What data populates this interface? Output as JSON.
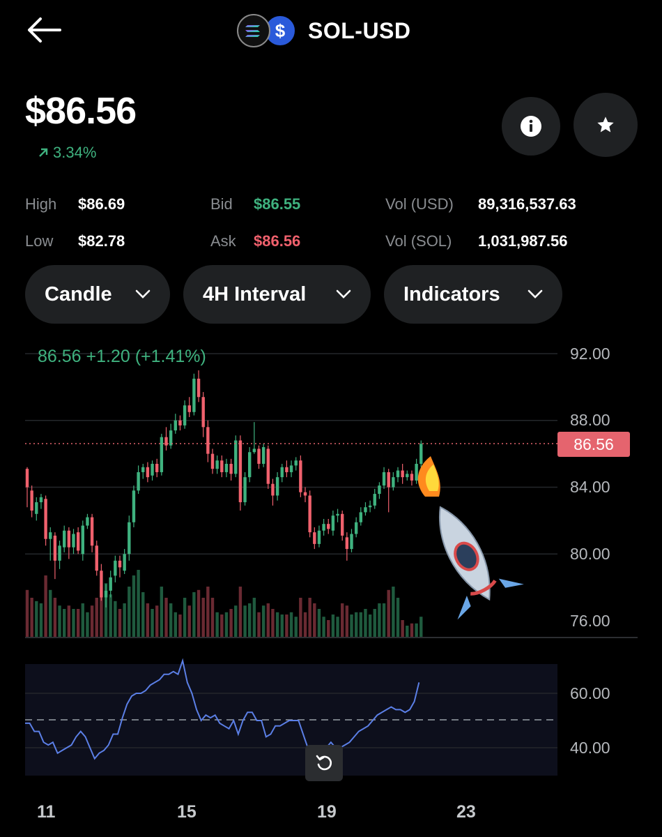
{
  "header": {
    "title": "SOL-USD",
    "base_icon": "solana-logo-icon",
    "quote_icon": "usd-coin-icon"
  },
  "price": {
    "current": "$86.56",
    "change_pct": "3.34%",
    "direction": "up"
  },
  "stats": {
    "high_label": "High",
    "high_value": "$86.69",
    "low_label": "Low",
    "low_value": "$82.78",
    "bid_label": "Bid",
    "bid_value": "$86.55",
    "ask_label": "Ask",
    "ask_value": "$86.56",
    "vol_usd_label": "Vol (USD)",
    "vol_usd_value": "89,316,537.63",
    "vol_sol_label": "Vol (SOL)",
    "vol_sol_value": "1,031,987.56"
  },
  "controls": {
    "chart_type": "Candle",
    "interval": "4H Interval",
    "indicators": "Indicators"
  },
  "chart": {
    "ohlc_summary": "86.56 +1.20 (+1.41%)",
    "price_axis": [
      "92.00",
      "88.00",
      "84.00",
      "80.00",
      "76.00"
    ],
    "current_price_tag": "86.56",
    "rsi_axis": [
      "60.00",
      "40.00"
    ],
    "date_axis": [
      "11",
      "15",
      "19",
      "23"
    ],
    "colors": {
      "up": "#3fb27f",
      "down": "#f0616d",
      "rsi_line": "#5b7fe6",
      "price_line": "#e5646e"
    }
  },
  "overlay": {
    "emoji_icon": "rocket-icon"
  },
  "chart_data": {
    "type": "candlestick",
    "title": "",
    "ylim": [
      76,
      92
    ],
    "candles": [
      [
        85.1,
        84.0,
        85.2,
        82.8
      ],
      [
        83.8,
        82.6,
        84.1,
        82.2
      ],
      [
        82.4,
        83.1,
        83.4,
        82.0
      ],
      [
        83.1,
        83.4,
        83.6,
        82.7
      ],
      [
        83.3,
        80.9,
        83.5,
        80.5
      ],
      [
        80.9,
        81.3,
        81.6,
        79.6
      ],
      [
        81.1,
        79.6,
        81.3,
        78.5
      ],
      [
        79.6,
        80.5,
        80.8,
        79.1
      ],
      [
        80.4,
        81.4,
        81.7,
        80.1
      ],
      [
        81.4,
        80.4,
        81.6,
        79.7
      ],
      [
        80.4,
        81.2,
        81.5,
        80.0
      ],
      [
        81.3,
        80.2,
        81.6,
        80.0
      ],
      [
        80.0,
        81.7,
        82.0,
        79.6
      ],
      [
        81.7,
        82.2,
        82.4,
        81.5
      ],
      [
        82.2,
        80.5,
        82.4,
        80.1
      ],
      [
        80.5,
        79.0,
        80.8,
        78.7
      ],
      [
        79.0,
        77.4,
        79.4,
        77.2
      ],
      [
        77.4,
        77.8,
        78.2,
        76.8
      ],
      [
        77.8,
        78.6,
        79.0,
        77.4
      ],
      [
        78.7,
        79.6,
        79.9,
        78.3
      ],
      [
        79.6,
        79.2,
        79.9,
        78.6
      ],
      [
        79.0,
        80.0,
        80.3,
        78.8
      ],
      [
        80.0,
        81.9,
        82.3,
        79.6
      ],
      [
        81.9,
        83.8,
        84.1,
        81.6
      ],
      [
        83.8,
        84.9,
        85.3,
        83.6
      ],
      [
        84.9,
        85.2,
        85.4,
        84.5
      ],
      [
        85.2,
        84.6,
        85.5,
        84.3
      ],
      [
        84.7,
        85.4,
        85.6,
        84.4
      ],
      [
        85.4,
        84.9,
        85.7,
        84.6
      ],
      [
        84.9,
        87.0,
        87.2,
        84.7
      ],
      [
        87.0,
        86.5,
        87.6,
        86.2
      ],
      [
        86.5,
        87.4,
        87.8,
        86.3
      ],
      [
        87.4,
        88.0,
        88.4,
        87.2
      ],
      [
        88.0,
        87.7,
        88.3,
        87.4
      ],
      [
        87.7,
        88.9,
        89.2,
        87.5
      ],
      [
        88.9,
        88.5,
        89.4,
        88.2
      ],
      [
        88.5,
        90.5,
        90.8,
        88.3
      ],
      [
        90.5,
        89.4,
        91.0,
        89.1
      ],
      [
        89.4,
        87.6,
        89.7,
        87.0
      ],
      [
        87.6,
        86.0,
        88.0,
        85.5
      ],
      [
        86.0,
        85.1,
        86.3,
        84.8
      ],
      [
        85.1,
        85.6,
        85.9,
        84.8
      ],
      [
        85.6,
        84.9,
        85.9,
        84.6
      ],
      [
        84.9,
        85.4,
        85.7,
        84.6
      ],
      [
        85.4,
        84.8,
        85.7,
        84.4
      ],
      [
        84.8,
        86.8,
        87.1,
        84.6
      ],
      [
        86.8,
        83.1,
        87.1,
        82.6
      ],
      [
        83.1,
        84.6,
        84.9,
        82.9
      ],
      [
        84.6,
        86.1,
        86.4,
        84.3
      ],
      [
        86.1,
        86.3,
        87.9,
        86.0
      ],
      [
        86.3,
        85.4,
        86.5,
        85.1
      ],
      [
        85.4,
        86.4,
        86.6,
        85.2
      ],
      [
        86.3,
        84.2,
        86.5,
        83.9
      ],
      [
        84.2,
        83.5,
        84.5,
        82.9
      ],
      [
        83.5,
        84.6,
        84.9,
        83.2
      ],
      [
        84.6,
        85.2,
        85.4,
        84.3
      ],
      [
        85.2,
        84.9,
        85.6,
        84.6
      ],
      [
        84.9,
        85.3,
        85.6,
        84.6
      ],
      [
        85.3,
        85.6,
        85.8,
        85.0
      ],
      [
        85.6,
        83.7,
        85.9,
        83.4
      ],
      [
        83.7,
        83.5,
        84.0,
        83.1
      ],
      [
        83.5,
        81.3,
        83.8,
        81.0
      ],
      [
        81.3,
        80.6,
        81.6,
        80.3
      ],
      [
        80.6,
        81.4,
        81.7,
        80.4
      ],
      [
        81.4,
        81.8,
        82.1,
        81.1
      ],
      [
        81.8,
        81.5,
        82.1,
        81.2
      ],
      [
        81.4,
        82.3,
        82.6,
        81.1
      ],
      [
        82.3,
        82.4,
        82.7,
        81.9
      ],
      [
        82.4,
        81.1,
        82.6,
        80.8
      ],
      [
        81.0,
        80.3,
        81.3,
        79.6
      ],
      [
        80.3,
        81.2,
        81.5,
        80.1
      ],
      [
        81.2,
        81.9,
        82.2,
        81.0
      ],
      [
        81.9,
        82.5,
        82.8,
        81.7
      ],
      [
        82.5,
        82.8,
        83.1,
        82.3
      ],
      [
        82.8,
        82.9,
        83.2,
        82.5
      ],
      [
        82.9,
        83.6,
        83.9,
        82.7
      ],
      [
        83.6,
        84.1,
        84.3,
        83.3
      ],
      [
        84.1,
        84.9,
        85.2,
        83.9
      ],
      [
        84.9,
        84.0,
        85.1,
        82.5
      ],
      [
        84.0,
        84.6,
        84.9,
        83.8
      ],
      [
        84.6,
        85.0,
        85.2,
        84.3
      ],
      [
        85.0,
        84.6,
        85.4,
        84.2
      ],
      [
        84.6,
        84.8,
        85.0,
        84.4
      ],
      [
        84.8,
        84.4,
        85.0,
        84.1
      ],
      [
        84.4,
        85.4,
        85.7,
        84.2
      ],
      [
        85.4,
        86.6,
        86.8,
        85.2
      ]
    ],
    "rsi": [
      49,
      49,
      46,
      46,
      42,
      41,
      42,
      38,
      39,
      40,
      41,
      44,
      46,
      44,
      40,
      36,
      38,
      39,
      41,
      45,
      45,
      51,
      56,
      59,
      60,
      60,
      61,
      63,
      64,
      65,
      67,
      67,
      68,
      67,
      72,
      64,
      60,
      54,
      50,
      52,
      51,
      52,
      49,
      48,
      47,
      50,
      45,
      50,
      53,
      53,
      50,
      50,
      44,
      45,
      48,
      48,
      49,
      50,
      50,
      50,
      45,
      40,
      35,
      38,
      39,
      40,
      42,
      40,
      40,
      41,
      42,
      44,
      46,
      47,
      48,
      50,
      52,
      53,
      54,
      55,
      54,
      54,
      53,
      54,
      57,
      64
    ],
    "volume": [
      0.42,
      0.35,
      0.32,
      0.3,
      0.55,
      0.42,
      0.35,
      0.28,
      0.25,
      0.28,
      0.25,
      0.25,
      0.3,
      0.22,
      0.28,
      0.35,
      0.45,
      0.48,
      0.38,
      0.32,
      0.25,
      0.3,
      0.45,
      0.55,
      0.6,
      0.4,
      0.3,
      0.25,
      0.28,
      0.45,
      0.35,
      0.3,
      0.22,
      0.2,
      0.35,
      0.28,
      0.4,
      0.42,
      0.35,
      0.45,
      0.35,
      0.22,
      0.2,
      0.22,
      0.25,
      0.28,
      0.45,
      0.28,
      0.3,
      0.35,
      0.22,
      0.28,
      0.3,
      0.25,
      0.22,
      0.2,
      0.2,
      0.22,
      0.18,
      0.35,
      0.22,
      0.35,
      0.3,
      0.25,
      0.18,
      0.15,
      0.2,
      0.18,
      0.3,
      0.28,
      0.2,
      0.22,
      0.22,
      0.25,
      0.2,
      0.25,
      0.3,
      0.3,
      0.42,
      0.45,
      0.35,
      0.15,
      0.1,
      0.12,
      0.12,
      0.18
    ]
  }
}
